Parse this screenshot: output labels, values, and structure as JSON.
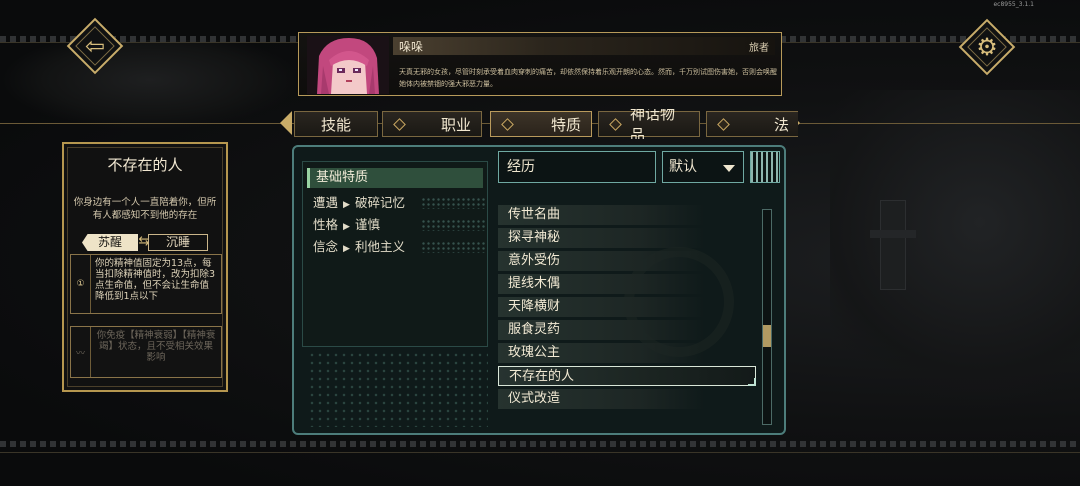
{
  "version": "ec8955_3.1.1",
  "character": {
    "name": "哚哚",
    "tag": "旅者",
    "description": "天真无邪的女孩，尽管时刻承受着血肉穿刺的痛苦，却依然保持着乐观开朗的心态。然而，千万别试图伤害她，否则会唤醒她体内被禁锢的强大邪恶力量。"
  },
  "tabs": [
    {
      "label": "技能",
      "active": false
    },
    {
      "label": "职业",
      "active": false
    },
    {
      "label": "特质",
      "active": true
    },
    {
      "label": "神话物品",
      "active": false
    },
    {
      "label": "法",
      "active": false
    }
  ],
  "trait": {
    "title": "不存在的人",
    "description": "你身边有一个人一直陪着你，但所有人都感知不到他的存在",
    "mode_awake": "苏醒",
    "mode_sleep": "沉睡",
    "effects": [
      {
        "icon": "①",
        "text": "你的精神值固定为13点，每当扣除精神值时，改为扣除3点生命值，但不会让生命值降低到1点以下",
        "active": true
      },
      {
        "icon": "〰",
        "text": "你免疫【精神衰弱】【精神衰竭】状态，且不受相关效果影响",
        "active": false
      }
    ]
  },
  "basic": {
    "header": "基础特质",
    "rows": [
      {
        "key": "遭遇",
        "value": "破碎记忆"
      },
      {
        "key": "性格",
        "value": "谨慎"
      },
      {
        "key": "信念",
        "value": "利他主义"
      }
    ]
  },
  "filter": {
    "category": "经历",
    "sort": "默认"
  },
  "trait_list": [
    "传世名曲",
    "探寻神秘",
    "意外受伤",
    "提线木偶",
    "天降横财",
    "服食灵药",
    "玫瑰公主",
    "不存在的人",
    "仪式改造"
  ],
  "selected_index": 7,
  "scroll_position": 0.6
}
